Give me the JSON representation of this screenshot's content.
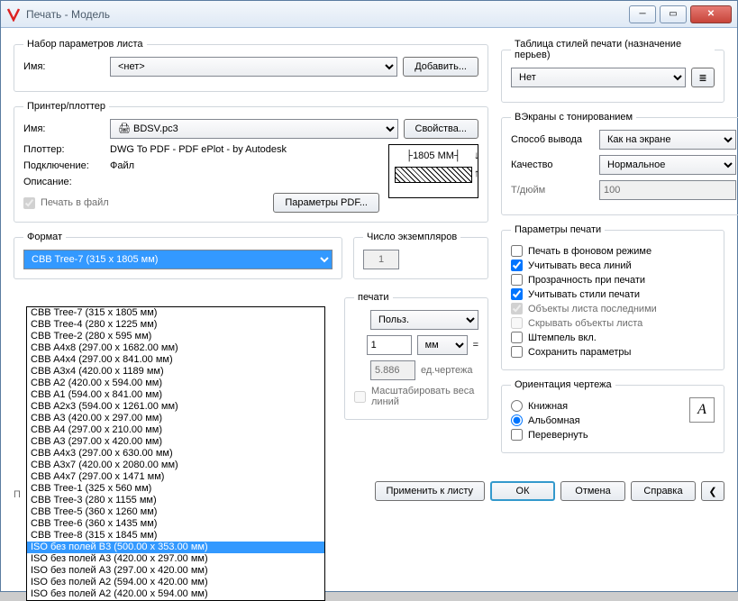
{
  "window": {
    "title": "Печать - Модель"
  },
  "pageSetup": {
    "legend": "Набор параметров листа",
    "nameLabel": "Имя:",
    "nameValue": "<нет>",
    "addBtn": "Добавить..."
  },
  "printer": {
    "legend": "Принтер/плоттер",
    "nameLabel": "Имя:",
    "nameValue": "BDSV.pc3",
    "propsBtn": "Свойства...",
    "plotterLabel": "Плоттер:",
    "plotterValue": "DWG To PDF - PDF ePlot - by Autodesk",
    "portLabel": "Подключение:",
    "portValue": "Файл",
    "descLabel": "Описание:",
    "plotToFile": "Печать в файл",
    "pdfBtn": "Параметры PDF...",
    "previewDim": "1805 MM"
  },
  "paper": {
    "legend": "Формат",
    "value": "CBB Tree-7 (315 x 1805 мм)",
    "options": [
      "CBB Tree-7 (315 x 1805 мм)",
      "CBB Tree-4 (280 x 1225 мм)",
      "CBB Tree-2 (280 x 595 мм)",
      "CBB A4x8 (297.00 x 1682.00 мм)",
      "CBB A4x4 (297.00 x 841.00 мм)",
      "CBB A3x4 (420.00 x 1189 мм)",
      "CBB A2 (420.00 x 594.00 мм)",
      "CBB A1 (594.00 x 841.00 мм)",
      "CBB A2x3 (594.00 x 1261.00 мм)",
      "CBB A3 (420.00 x 297.00 мм)",
      "CBB A4 (297.00 x 210.00 мм)",
      "CBB A3 (297.00 x 420.00 мм)",
      "CBB A4x3 (297.00 x 630.00 мм)",
      "CBB A3x7 (420.00 x 2080.00 мм)",
      "CBB A4x7 (297.00 x 1471 мм)",
      "CBB Tree-1 (325 x 560 мм)",
      "CBB Tree-3 (280 x 1155 мм)",
      "CBB Tree-5 (360 x 1260 мм)",
      "CBB Tree-6 (360 x 1435 мм)",
      "CBB Tree-8 (315 x 1845 мм)",
      "ISO без полей B3 (500.00 x 353.00 мм)",
      "ISO без полей A3 (420.00 x 297.00 мм)",
      "ISO без полей A3 (297.00 x 420.00 мм)",
      "ISO без полей A2 (594.00 x 420.00 мм)",
      "ISO без полей A2 (420.00 x 594.00 мм)"
    ],
    "selectedIndex": 20
  },
  "copies": {
    "legend": "Число экземпляров",
    "value": "1"
  },
  "area": {
    "legend": "печати"
  },
  "scale": {
    "valueTop": "1",
    "unitTop": "мм",
    "eq": "=",
    "valueBot": "5.886",
    "unitBot": "ед.чертежа",
    "lw": "Масштабировать веса линий",
    "custom": "Польз."
  },
  "styles": {
    "legend": "Таблица стилей печати (назначение перьев)",
    "value": "Нет"
  },
  "shade": {
    "legend": "ВЭкраны с тонированием",
    "outLabel": "Способ вывода",
    "outVal": "Как на экране",
    "qLabel": "Качество",
    "qVal": "Нормальное",
    "dpiLabel": "Т/дюйм",
    "dpiVal": "100"
  },
  "opts": {
    "legend": "Параметры печати",
    "bg": "Печать в фоновом режиме",
    "lw": "Учитывать веса линий",
    "tr": "Прозрачность при печати",
    "ps": "Учитывать стили печати",
    "last": "Объекты листа последними",
    "hide": "Скрывать объекты листа",
    "stamp": "Штемпель вкл.",
    "save": "Сохранить параметры"
  },
  "orient": {
    "legend": "Ориентация чертежа",
    "port": "Книжная",
    "land": "Альбомная",
    "ups": "Перевернуть"
  },
  "footer": {
    "apply": "Применить к листу",
    "ok": "ОК",
    "cancel": "Отмена",
    "help": "Справка"
  },
  "applyLabel": "П"
}
